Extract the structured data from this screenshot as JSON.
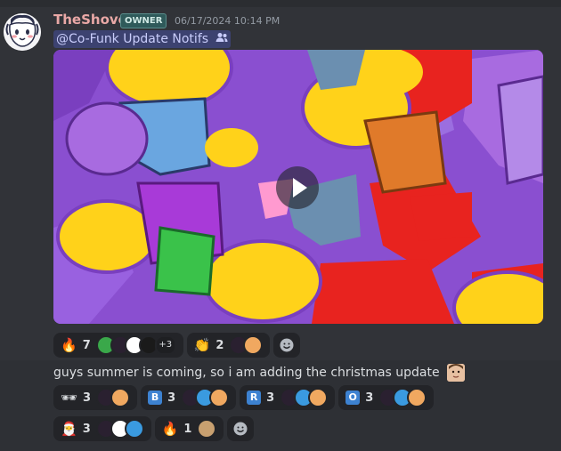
{
  "message1": {
    "username": "TheShovel",
    "role_badge": "OWNER",
    "timestamp": "06/17/2024 10:14 PM",
    "mention": "@Co-Funk Update Notifs",
    "mention_icon": "people-icon",
    "attachment": {
      "type": "video",
      "play_icon": "play-icon"
    },
    "reactions": [
      {
        "emoji": "🔥",
        "count": "7",
        "avatars": 4,
        "more": "+3"
      },
      {
        "emoji": "👏",
        "count": "2",
        "avatars": 2
      }
    ],
    "add_reaction_icon": "smiley-add-icon"
  },
  "message2": {
    "text": "guys summer is coming, so i am adding the christmas update",
    "emoji": "face-emoji",
    "reactions": [
      {
        "emoji": "🕶",
        "count": "3",
        "avatars": 2
      },
      {
        "emoji": "B",
        "count": "3",
        "avatars": 3
      },
      {
        "emoji": "R",
        "count": "3",
        "avatars": 3
      },
      {
        "emoji": "O",
        "count": "3",
        "avatars": 3
      },
      {
        "emoji": "🎅",
        "count": "3",
        "avatars": 3
      },
      {
        "emoji": "🔥",
        "count": "1",
        "avatars": 1
      }
    ],
    "add_reaction_icon": "smiley-add-icon"
  },
  "colors": {
    "background": "#313338",
    "username": "#e9a8a6",
    "mention_bg": "#3c4270",
    "reaction_bg": "#232428",
    "letter_emoji_bg": "#3d82d1"
  }
}
